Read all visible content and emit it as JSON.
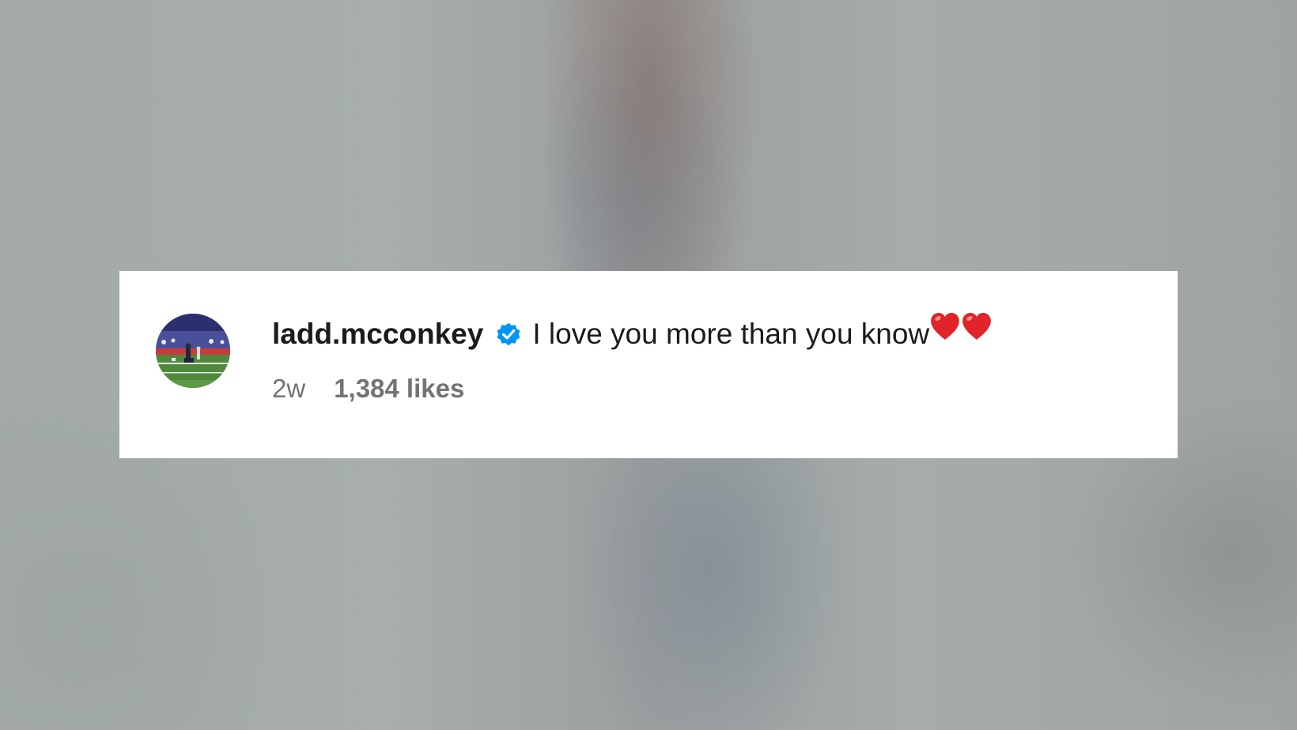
{
  "comment": {
    "username": "ladd.mcconkey",
    "verified": true,
    "text": "I love you more than you know",
    "emoji": [
      "red-heart",
      "red-heart"
    ],
    "timestamp": "2w",
    "likes": "1,384 likes"
  },
  "colors": {
    "verified_badge": "#0095f6",
    "username_text": "#1b1b1b",
    "meta_text": "#737373",
    "heart": "#e0242a",
    "card_background": "#ffffff"
  }
}
